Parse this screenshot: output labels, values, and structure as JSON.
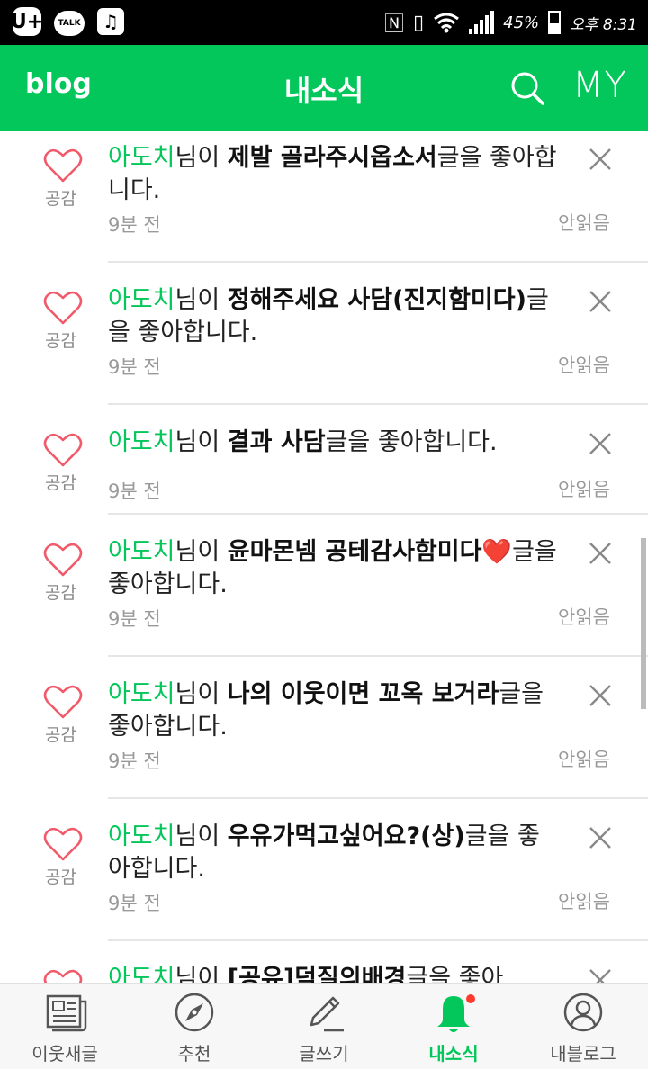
{
  "statusbar": {
    "apps": [
      "U+",
      "TALK",
      "♫"
    ],
    "battery": "45%",
    "time": "오후 8:31"
  },
  "header": {
    "logo": "blog",
    "title": "내소식",
    "my": "MY"
  },
  "like_label": "공감",
  "unread_label": "안읽음",
  "notifications": [
    {
      "name": "아도치",
      "mid": "님이 ",
      "post": "제발 골라주시옵소서",
      "suffix": "글을 좋아합니다.",
      "time": "9분 전"
    },
    {
      "name": "아도치",
      "mid": "님이 ",
      "post": "정해주세요 사담(진지함미다)",
      "suffix": "글을 좋아합니다.",
      "time": "9분 전"
    },
    {
      "name": "아도치",
      "mid": "님이 ",
      "post": "결과 사담",
      "suffix": "글을 좋아합니다.",
      "time": "9분 전"
    },
    {
      "name": "아도치",
      "mid": "님이 ",
      "post": "윤마몬넴 공테감사함미다❤️",
      "suffix": "글을 좋아합니다.",
      "time": "9분 전"
    },
    {
      "name": "아도치",
      "mid": "님이 ",
      "post": "나의 이웃이면 꼬옥 보거라",
      "suffix": "글을 좋아합니다.",
      "time": "9분 전"
    },
    {
      "name": "아도치",
      "mid": "님이 ",
      "post": "우유가먹고싶어요?(상)",
      "suffix": "글을 좋아합니다.",
      "time": "9분 전"
    },
    {
      "name": "아도치",
      "mid": "님이 ",
      "post": "[공유]덕질의배경",
      "suffix": "글을 좋아",
      "time": ""
    }
  ],
  "bottomnav": [
    {
      "label": "이웃새글",
      "icon": "news-icon"
    },
    {
      "label": "추천",
      "icon": "compass-icon"
    },
    {
      "label": "글쓰기",
      "icon": "pencil-icon"
    },
    {
      "label": "내소식",
      "icon": "bell-icon"
    },
    {
      "label": "내블로그",
      "icon": "profile-icon"
    }
  ],
  "colors": {
    "accent": "#03c75a",
    "badge": "#ff3b30"
  }
}
